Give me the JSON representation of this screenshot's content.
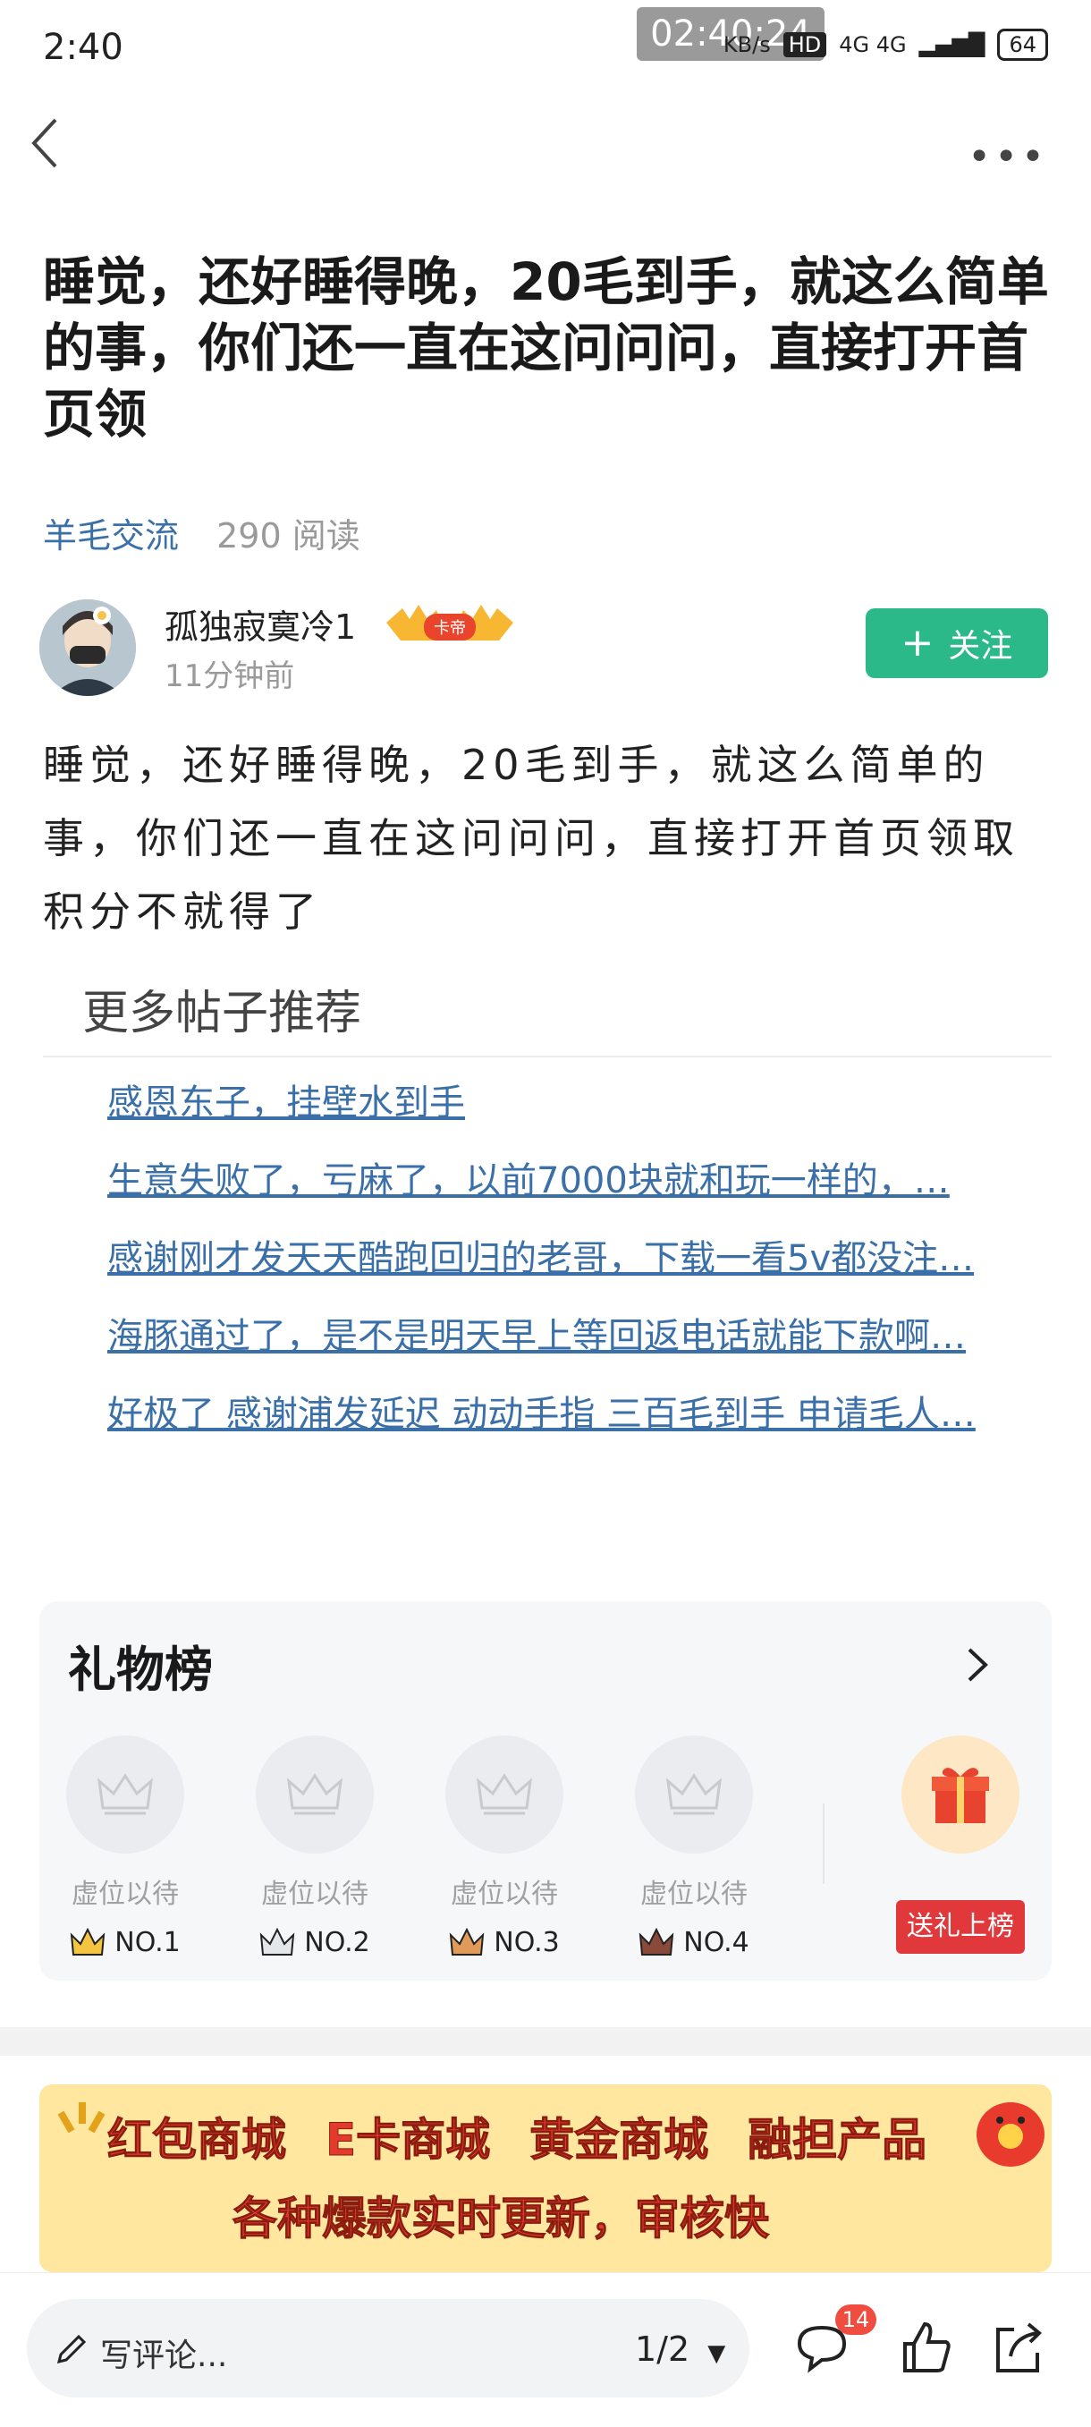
{
  "status_bar": {
    "time": "2:40",
    "overlay_clock": "02:40:24",
    "network": "4G 4G",
    "speed": "KB/s",
    "hd": "HD",
    "battery": "64"
  },
  "post": {
    "title": "睡觉，还好睡得晚，20毛到手，就这么简单的事，你们还一直在这问问问，直接打开首页领",
    "category": "羊毛交流",
    "reads": "290 阅读",
    "author": {
      "name": "孤独寂寞冷1",
      "badge": "卡帝",
      "time": "11分钟前",
      "follow_label": "关注"
    },
    "body": "睡觉，还好睡得晚，20毛到手，就这么简单的事，你们还一直在这问问问，直接打开首页领取积分不就得了"
  },
  "recommend": {
    "heading": "更多帖子推荐",
    "items": [
      "感恩东子，挂壁水到手",
      "生意失败了，亏麻了，以前7000块就和玩一样的，…",
      "感谢刚才发天天酷跑回归的老哥，下载一看5v都没注…",
      "海豚通过了，是不是明天早上等回返电话就能下款啊…",
      "好极了 感谢浦发延迟 动动手指 三百毛到手 申请毛人…"
    ]
  },
  "gift_board": {
    "title": "礼物榜",
    "slots": [
      {
        "label": "虚位以待",
        "rank": "NO.1"
      },
      {
        "label": "虚位以待",
        "rank": "NO.2"
      },
      {
        "label": "虚位以待",
        "rank": "NO.3"
      },
      {
        "label": "虚位以待",
        "rank": "NO.4"
      }
    ],
    "send_label": "送礼上榜"
  },
  "banner": {
    "row1": [
      "红包商城",
      "E卡商城",
      "黄金商城",
      "融担产品"
    ],
    "row2": "各种爆款实时更新，审核快"
  },
  "bottom_bar": {
    "comment_placeholder": "写评论...",
    "page": "1/2",
    "comment_count": "14"
  },
  "colors": {
    "accent_green": "#2bb98a",
    "link_blue": "#3a6fa8",
    "badge_red": "#e0383b"
  }
}
